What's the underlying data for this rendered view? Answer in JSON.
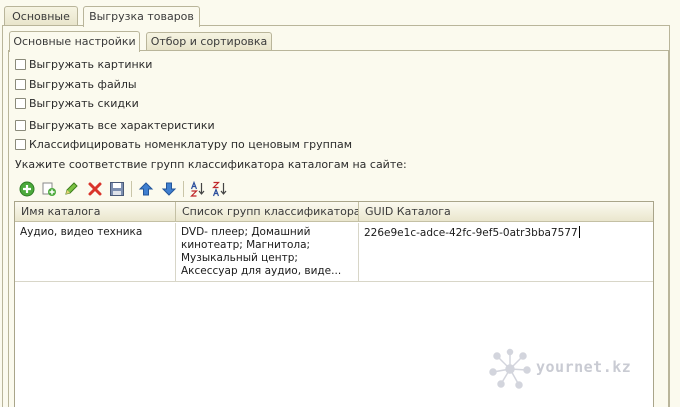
{
  "top_tabs": [
    {
      "label": "Основные",
      "active": false
    },
    {
      "label": "Выгрузка товаров",
      "active": true
    }
  ],
  "sub_tabs": [
    {
      "label": "Основные настройки",
      "active": true
    },
    {
      "label": "Отбор и сортировка",
      "active": false
    }
  ],
  "checkboxes": [
    {
      "label": "Выгружать картинки",
      "checked": false
    },
    {
      "label": "Выгружать файлы",
      "checked": false
    },
    {
      "label": "Выгружать скидки",
      "checked": false
    },
    {
      "label": "Выгружать все характеристики",
      "checked": false
    },
    {
      "label": "Классифицировать номенклатуру по ценовым группам",
      "checked": false
    }
  ],
  "instruction": "Укажите соответствие групп классификатора каталогам на сайте:",
  "toolbar_icons": [
    "add-icon",
    "copy-icon",
    "edit-icon",
    "delete-icon",
    "save-icon",
    "move-up-icon",
    "move-down-icon",
    "sort-ascending-icon",
    "sort-descending-icon"
  ],
  "table": {
    "columns": [
      "Имя каталога",
      "Список групп классификатора н...",
      "GUID Каталога"
    ],
    "rows": [
      {
        "name": "Аудио, видео техника",
        "groups": "DVD- плеер; Домашний кинотеатр; Магнитола; Музыкальный центр; Аксессуар для аудио, виде...",
        "guid": "226e9e1c-adce-42fc-9ef5-0atr3bba7577"
      }
    ]
  },
  "watermark": "yournet.kz",
  "colors": {
    "panel": "#fbfaee",
    "border": "#b9b59a",
    "add": "#4caa3c",
    "delete": "#d9342b",
    "arrow": "#3f7fd0"
  }
}
